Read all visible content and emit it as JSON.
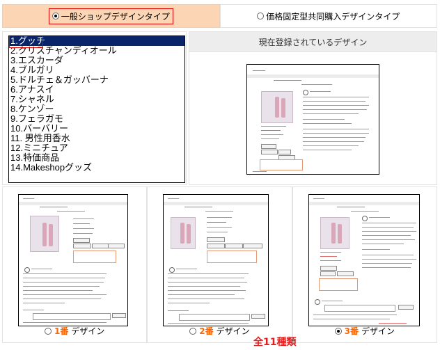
{
  "tabs": [
    {
      "label": "一般ショップデザインタイプ",
      "selected": true
    },
    {
      "label": "価格固定型共同購入デザインタイプ",
      "selected": false
    }
  ],
  "list": {
    "items": [
      "1.グッチ",
      "2.クリスチャンディオール",
      "3.エスカーダ",
      "4.ブルガリ",
      "5.ドルチェ＆ガッバーナ",
      "6.アナスイ",
      "7.シャネル",
      "8.ケンゾー",
      "9.フェラガモ",
      "10.バーバリー",
      "11. 男性用香水",
      "12.ミニチュア",
      "13.特価商品",
      "14.Makeshopグッズ"
    ],
    "selected_index": 0
  },
  "current": {
    "header": "現在登録されているデザイン"
  },
  "options": [
    {
      "num": "1番",
      "suffix": "デザイン",
      "selected": false
    },
    {
      "num": "2番",
      "suffix": "デザイン",
      "selected": false
    },
    {
      "num": "3番",
      "suffix": "デザイン",
      "selected": true
    }
  ],
  "total_label": "全11種類",
  "colors": {
    "selected_tab_bg": "#fcd5b4",
    "list_highlight": "#0a246a",
    "accent_red": "#e02020",
    "number_orange": "#ff6600"
  }
}
